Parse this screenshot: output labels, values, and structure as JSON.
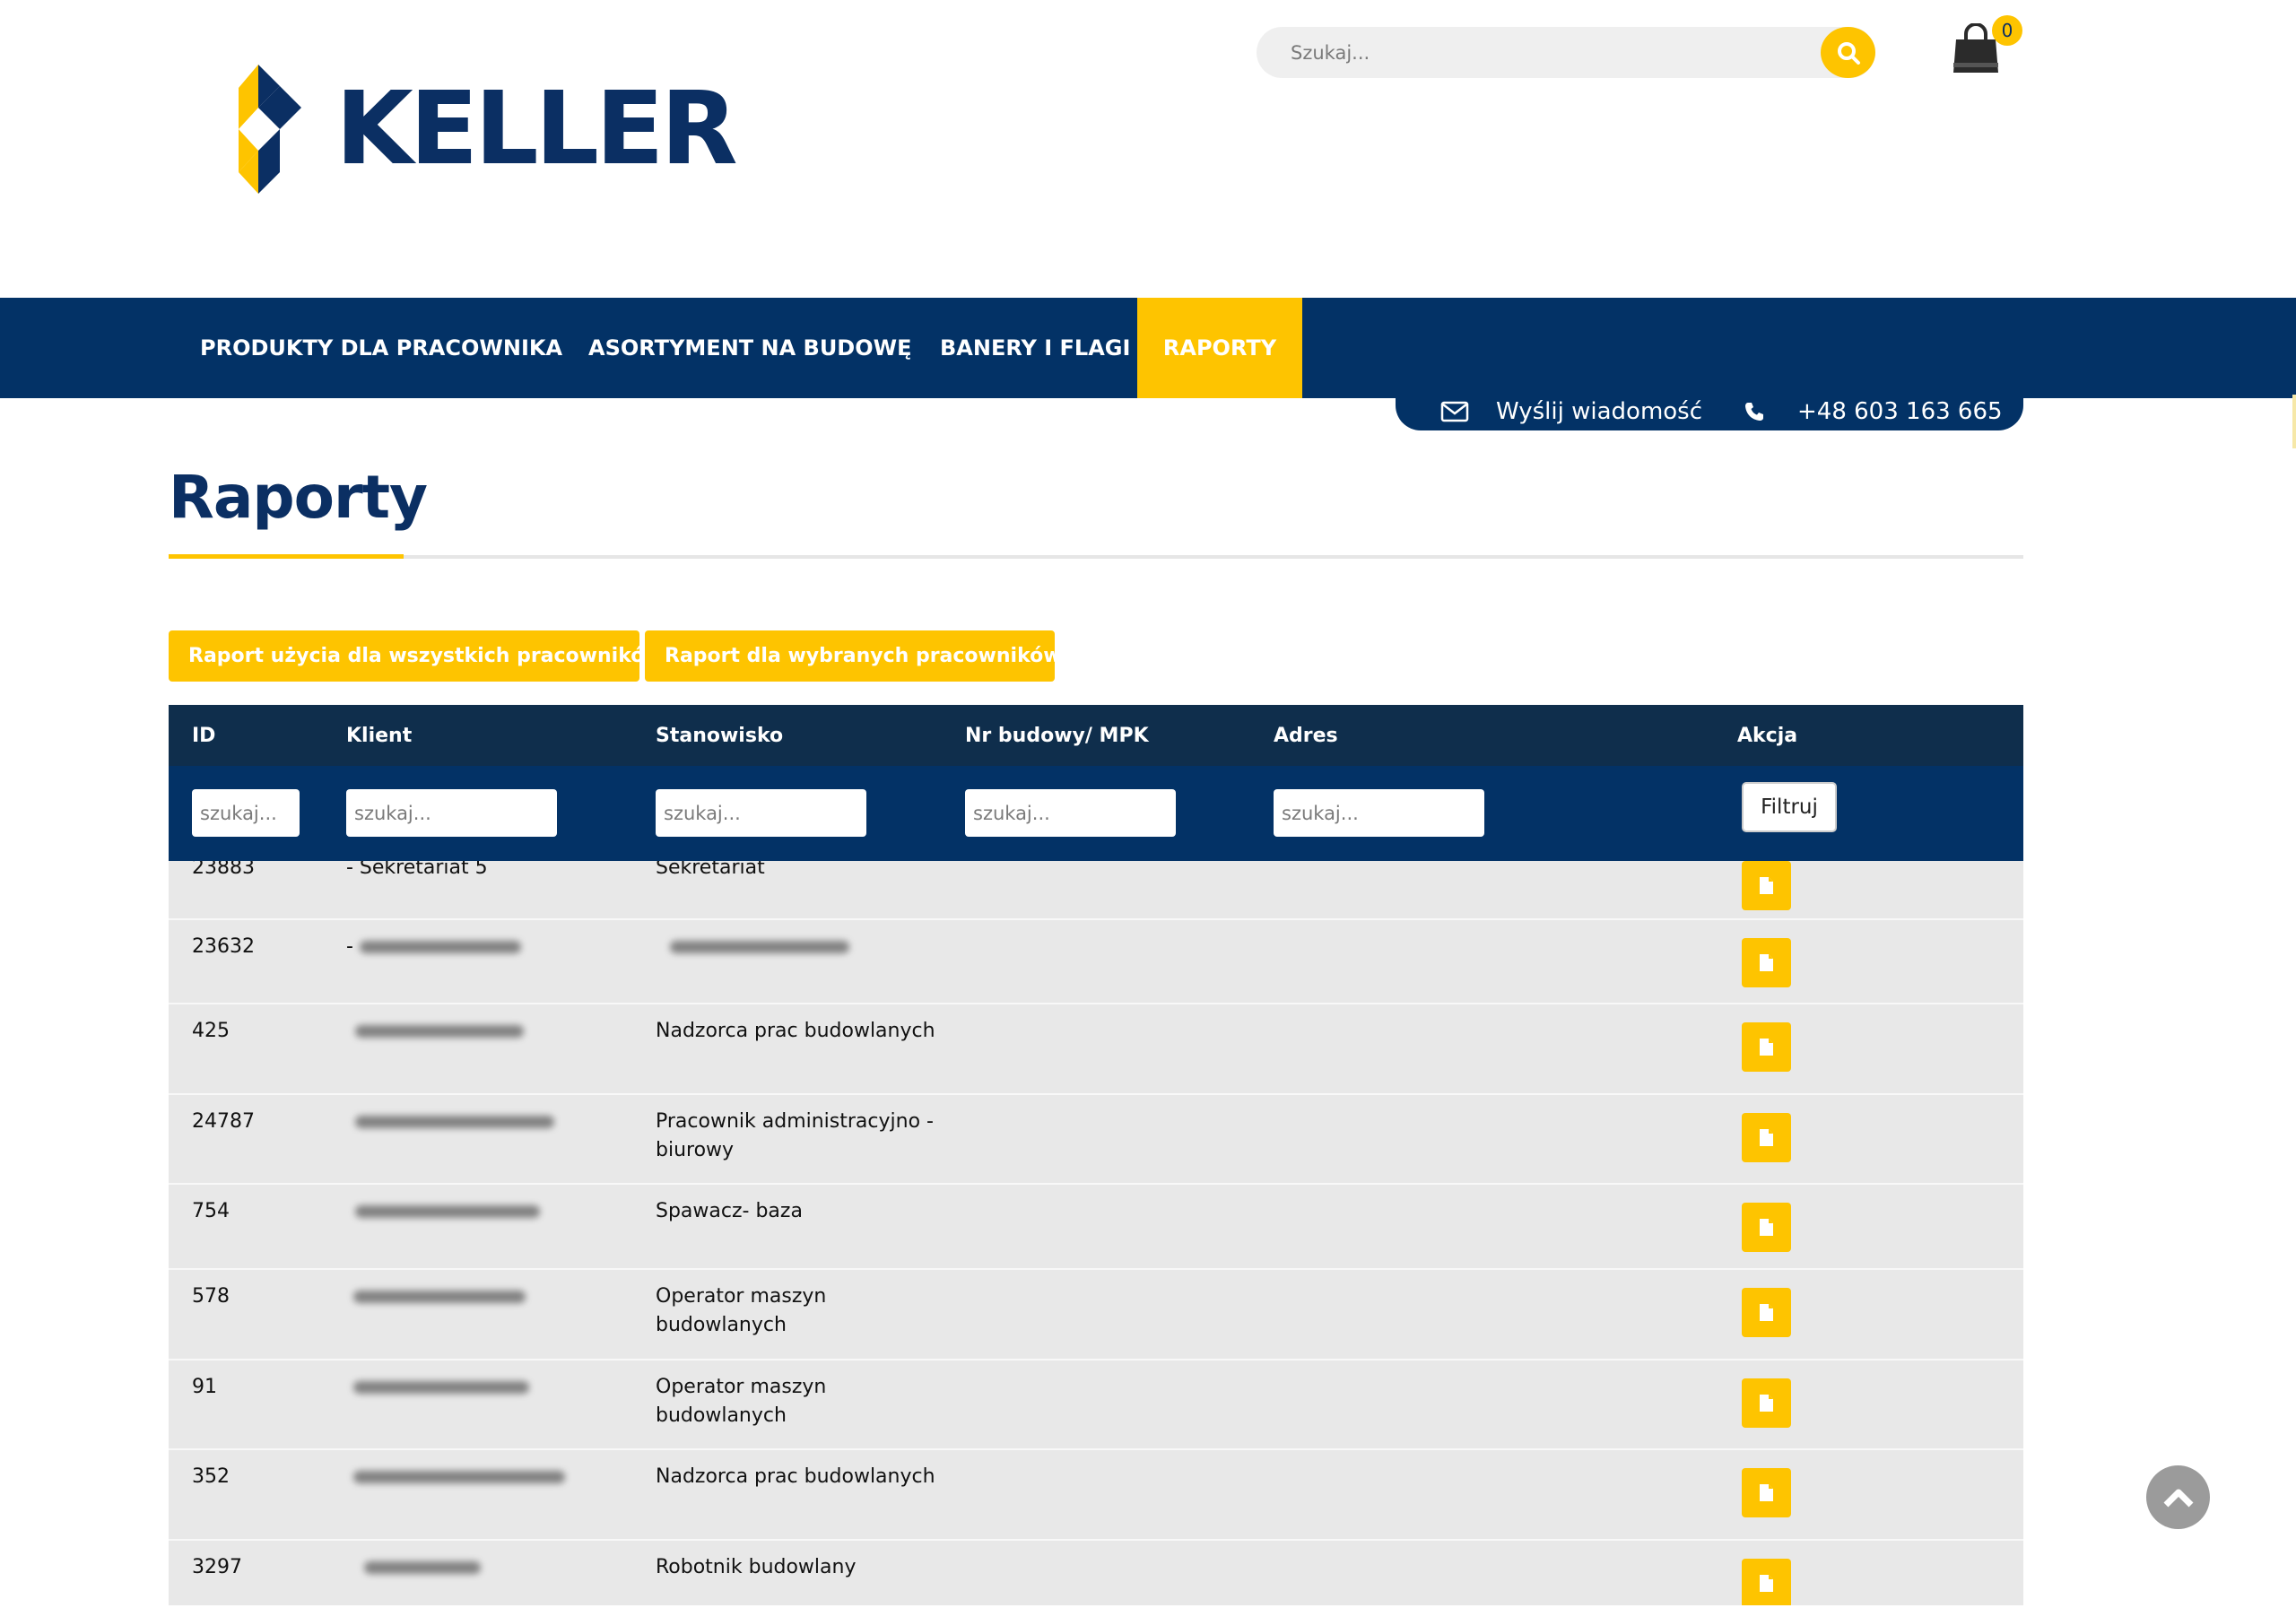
{
  "brand": {
    "name": "KELLER",
    "logo_colors": [
      "#fec400",
      "#0b2f63"
    ]
  },
  "search": {
    "placeholder": "Szukaj...",
    "icon": "search-icon"
  },
  "cart": {
    "count": "0",
    "icon": "shopping-bag-icon"
  },
  "nav": {
    "items": [
      {
        "label": "PRODUKTY DLA PRACOWNIKA"
      },
      {
        "label": "ASORTYMENT NA BUDOWĘ"
      },
      {
        "label": "BANERY I FLAGI"
      },
      {
        "label": "RAPORTY",
        "active": true
      }
    ]
  },
  "contact": {
    "message_label": "Wyślij wiadomość",
    "message_icon": "envelope-icon",
    "phone": "+48 603 163 665",
    "phone_icon": "phone-icon"
  },
  "page": {
    "title": "Raporty"
  },
  "actions": {
    "all_report": "Raport użycia dla wszystkich pracowników",
    "selected_report": "Raport dla wybranych pracowników"
  },
  "table": {
    "columns": {
      "id": "ID",
      "klient": "Klient",
      "stanowisko": "Stanowisko",
      "nr_budowy": "Nr budowy/ MPK",
      "adres": "Adres",
      "akcja": "Akcja"
    },
    "filter_placeholder": "szukaj...",
    "filter_button": "Filtruj",
    "rows": [
      {
        "id": "23883",
        "klient": "- Sekretariat 5",
        "stanowisko": "Sekretariat"
      },
      {
        "id": "23632",
        "klient": "- ",
        "stanowisko": ""
      },
      {
        "id": "425",
        "klient": "",
        "stanowisko": "Nadzorca prac budowlanych"
      },
      {
        "id": "24787",
        "klient": "",
        "stanowisko": "Pracownik administracyjno - biurowy"
      },
      {
        "id": "754",
        "klient": "",
        "stanowisko": "Spawacz- baza"
      },
      {
        "id": "578",
        "klient": "",
        "stanowisko": "Operator maszyn budowlanych"
      },
      {
        "id": "91",
        "klient": "",
        "stanowisko": "Operator maszyn budowlanych"
      },
      {
        "id": "352",
        "klient": "",
        "stanowisko": "Nadzorca prac budowlanych"
      },
      {
        "id": "3297",
        "klient": "",
        "stanowisko": "Robotnik budowlany"
      }
    ]
  },
  "colors": {
    "accent": "#fec400",
    "navy": "#033266",
    "header_dark": "#0f2e4c",
    "row_bg": "#e8e8e8"
  }
}
